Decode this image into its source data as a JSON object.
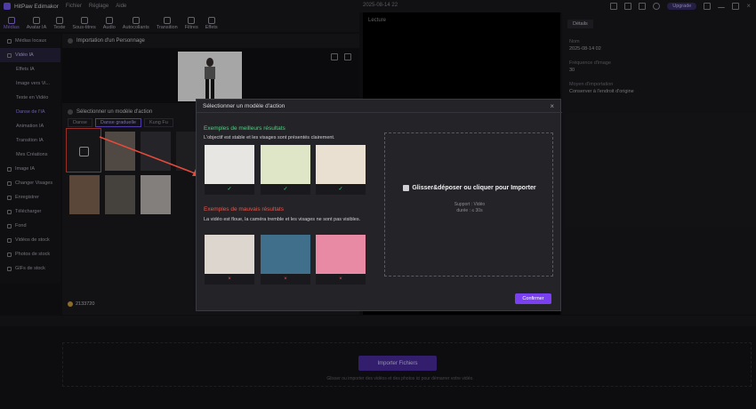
{
  "app": {
    "name": "HitPaw Edimakor",
    "menu": [
      "Fichier",
      "Réglage",
      "Aide"
    ],
    "date": "2025-08-14 22",
    "upgrade": "Upgrade"
  },
  "toolbar": {
    "items": [
      "Médias",
      "Avatar IA",
      "Texte",
      "Sous-titres",
      "Audio",
      "Autocollants",
      "Transition",
      "Filtres",
      "Effets"
    ]
  },
  "sidebar": {
    "items": [
      {
        "label": "Médias locaux",
        "type": "main"
      },
      {
        "label": "Vidéo IA",
        "type": "active"
      },
      {
        "label": "Effets IA",
        "type": "sub"
      },
      {
        "label": "Image vers Vi...",
        "type": "sub"
      },
      {
        "label": "Texte en Vidéo",
        "type": "sub"
      },
      {
        "label": "Danse de l'IA",
        "type": "sub-hl"
      },
      {
        "label": "Animation IA",
        "type": "sub"
      },
      {
        "label": "Transition IA",
        "type": "sub"
      },
      {
        "label": "Mes Créations",
        "type": "sub"
      },
      {
        "label": "Image IA",
        "type": "main"
      },
      {
        "label": "Changer Visages",
        "type": "main"
      },
      {
        "label": "Enregistrer",
        "type": "main"
      },
      {
        "label": "Télécharger",
        "type": "main"
      },
      {
        "label": "Fond",
        "type": "main"
      },
      {
        "label": "Vidéos de stock",
        "type": "main"
      },
      {
        "label": "Photos de stock",
        "type": "main"
      },
      {
        "label": "GIFs de stock",
        "type": "main"
      }
    ]
  },
  "panel": {
    "section1": "Importation d'un Personnage",
    "section2": "Sélectionner un modèle d'action",
    "tabs": [
      "Danse",
      "Danse graduelle",
      "Kung Fu"
    ],
    "credits": "2133720"
  },
  "lecture": {
    "label": "Lecture"
  },
  "details": {
    "tab": "Détails",
    "fields": [
      {
        "label": "Nom",
        "value": "2025-08-14 02"
      },
      {
        "label": "Fréquence d'image",
        "value": "30"
      },
      {
        "label": "Moyen d'importation",
        "value": "Conserver à l'endroit d'origine"
      }
    ]
  },
  "timeline": {
    "import_label": "Importer Fichiers",
    "hint": "Glisser ou importer des vidéos et des photos ici pour démarrer votre vidéo."
  },
  "modal": {
    "title": "Sélectionner un modèle d'action",
    "close": "×",
    "good_title": "Exemples de meilleurs résultats",
    "good_desc": "L'objectif est stable et les visages sont présentés clairement.",
    "bad_title": "Exemples de mauvais résultats",
    "bad_desc": "La vidéo est floue, la caméra tremble et les visages ne sont pas visibles.",
    "good_mark": "✓",
    "bad_mark": "×",
    "dropzone_main": "Glisser&déposer ou cliquer pour Importer",
    "dropzone_support": "Support : Vidéo",
    "dropzone_duration": "durée : ≤ 30s",
    "confirm": "Confirmer"
  },
  "colors": {
    "accent": "#7b3ff2",
    "good": "#4cd07d",
    "bad": "#e8564a"
  }
}
